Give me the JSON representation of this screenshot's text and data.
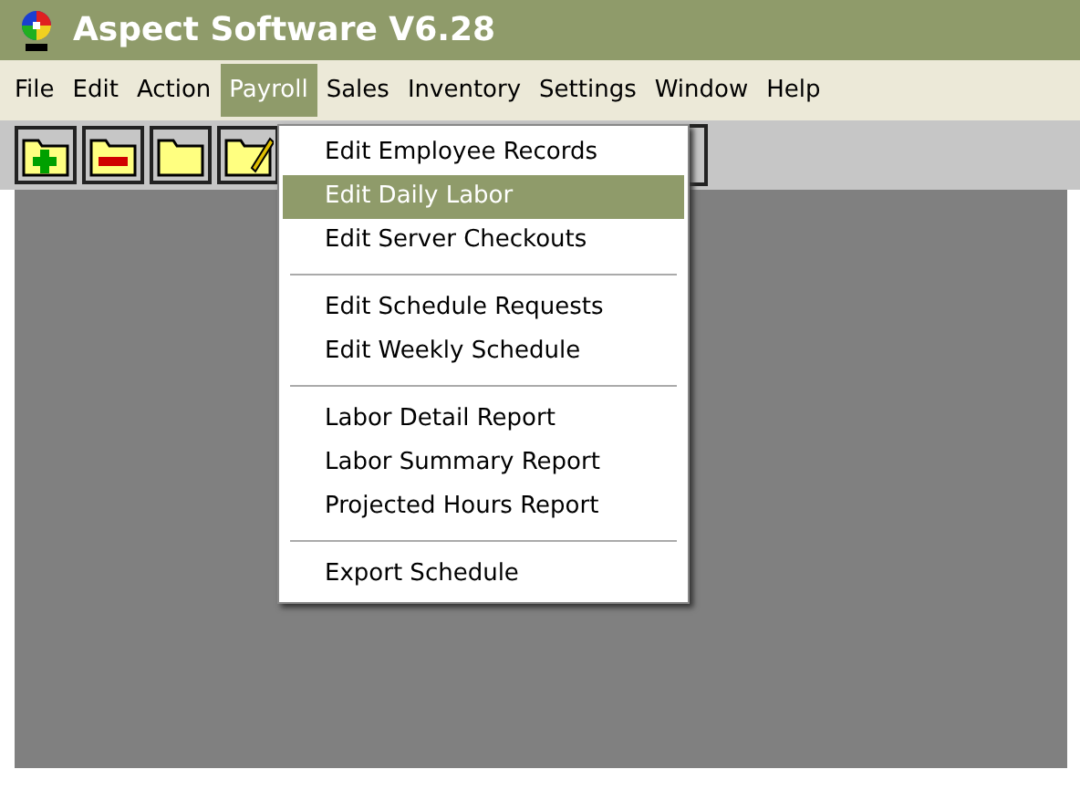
{
  "window": {
    "title": "Aspect Software V6.28"
  },
  "menu_bar": [
    {
      "label": "File",
      "selected": false
    },
    {
      "label": "Edit",
      "selected": false
    },
    {
      "label": "Action",
      "selected": false
    },
    {
      "label": "Payroll",
      "selected": true
    },
    {
      "label": "Sales",
      "selected": false
    },
    {
      "label": "Inventory",
      "selected": false
    },
    {
      "label": "Settings",
      "selected": false
    },
    {
      "label": "Window",
      "selected": false
    },
    {
      "label": "Help",
      "selected": false
    }
  ],
  "toolbar": [
    {
      "kind": "add"
    },
    {
      "kind": "remove"
    },
    {
      "kind": "folder"
    },
    {
      "kind": "edit"
    }
  ],
  "dropdown": [
    {
      "kind": "item",
      "label": "Edit Employee Records",
      "selected": false
    },
    {
      "kind": "item",
      "label": "Edit Daily Labor",
      "selected": true
    },
    {
      "kind": "item",
      "label": "Edit Server Checkouts",
      "selected": false
    },
    {
      "kind": "separator"
    },
    {
      "kind": "item",
      "label": "Edit Schedule Requests",
      "selected": false
    },
    {
      "kind": "item",
      "label": "Edit Weekly Schedule",
      "selected": false
    },
    {
      "kind": "separator"
    },
    {
      "kind": "item",
      "label": "Labor Detail Report",
      "selected": false
    },
    {
      "kind": "item",
      "label": "Labor Summary Report",
      "selected": false
    },
    {
      "kind": "item",
      "label": "Projected Hours Report",
      "selected": false
    },
    {
      "kind": "separator"
    },
    {
      "kind": "item",
      "label": "Export Schedule",
      "selected": false
    }
  ]
}
